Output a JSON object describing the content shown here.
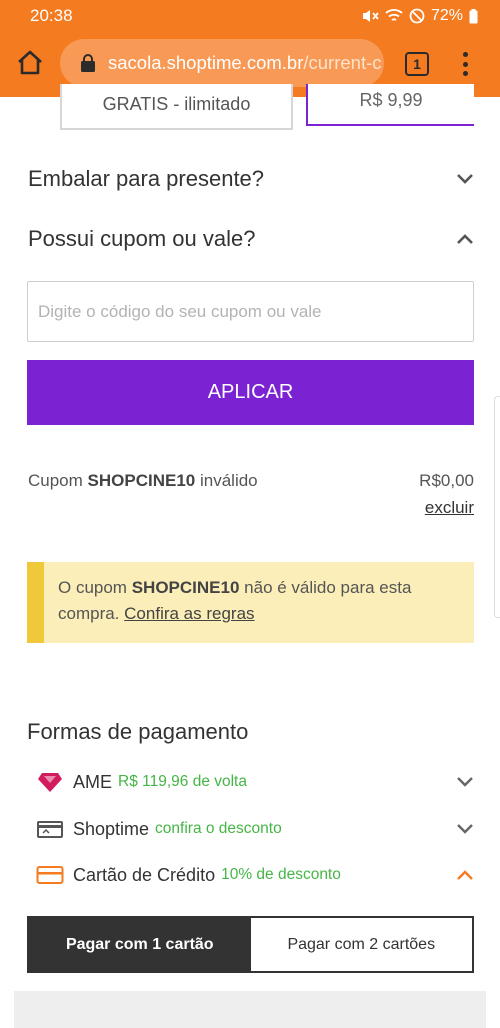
{
  "status_bar": {
    "time": "20:38",
    "battery": "72%"
  },
  "browser": {
    "url_host": "sacola.shoptime.com.br",
    "url_path": "/current-c",
    "tab_count": "1"
  },
  "shipping": {
    "free_label": "GRATIS - ilimitado",
    "paid_label": "R$ 9,99"
  },
  "gift_wrap": {
    "title": "Embalar para presente?",
    "expanded": false
  },
  "coupon_section": {
    "title": "Possui cupom ou vale?",
    "expanded": true,
    "input_placeholder": "Digite o código do seu cupom ou vale",
    "input_value": "",
    "apply_label": "APLICAR"
  },
  "coupon_result": {
    "prefix": "Cupom",
    "code": "SHOPCINE10",
    "status": "inválido",
    "value": "R$0,00",
    "remove_label": "excluir"
  },
  "alert": {
    "prefix": "O cupom",
    "code": "SHOPCINE10",
    "message": "não é válido para esta compra.",
    "link_label": "Confira as regras"
  },
  "payment": {
    "title": "Formas de pagamento",
    "methods": [
      {
        "name": "AME",
        "note": "R$ 119,96 de volta",
        "icon": "ame-heart-icon",
        "expanded": false
      },
      {
        "name": "Shoptime",
        "note": "confira o desconto",
        "icon": "shoptime-card-icon",
        "expanded": false
      },
      {
        "name": "Cartão de Crédito",
        "note": "10% de desconto",
        "icon": "credit-card-icon",
        "expanded": true
      }
    ],
    "installment_options": [
      "Pagar com 1 cartão",
      "Pagar com 2 cartões"
    ],
    "selected_installment": 0
  },
  "colors": {
    "browser_bar": "#f47b20",
    "primary_purple": "#7b22d3",
    "alert_background": "#fbeeb8",
    "alert_accent": "#f0c93a",
    "discount_green": "#46b546",
    "ame_pink": "#d11d5e",
    "credit_orange": "#f47b20"
  }
}
